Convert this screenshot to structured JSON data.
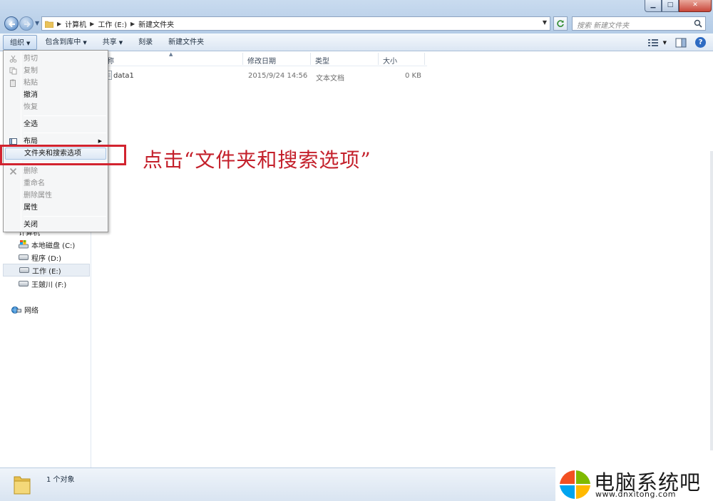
{
  "address": {
    "segments": [
      "计算机",
      "工作 (E:)",
      "新建文件夹"
    ]
  },
  "search": {
    "placeholder": "搜索 新建文件夹"
  },
  "window_controls": {
    "minimize": "▁",
    "maximize": "□",
    "close": "✕"
  },
  "toolbar": {
    "organize": "组织",
    "include_library": "包含到库中",
    "share": "共享",
    "burn": "刻录",
    "new_folder": "新建文件夹",
    "caret": "▼",
    "help": "?"
  },
  "columns": {
    "name_partial": "称",
    "date": "修改日期",
    "type": "类型",
    "size": "大小"
  },
  "files": [
    {
      "name": "data1",
      "date": "2015/9/24 14:56",
      "type": "文本文档",
      "size": "0 KB"
    }
  ],
  "menu": {
    "items": [
      {
        "label": "剪切",
        "enabled": false
      },
      {
        "label": "复制",
        "enabled": false
      },
      {
        "label": "粘贴",
        "enabled": false
      },
      {
        "label": "撤消",
        "enabled": true
      },
      {
        "label": "恢复",
        "enabled": false
      },
      {
        "label": "全选",
        "enabled": true
      },
      {
        "label": "布局",
        "enabled": true
      },
      {
        "label": "文件夹和搜索选项",
        "enabled": true
      },
      {
        "label": "删除",
        "enabled": false
      },
      {
        "label": "重命名",
        "enabled": false
      },
      {
        "label": "删除属性",
        "enabled": false
      },
      {
        "label": "属性",
        "enabled": true
      },
      {
        "label": "关闭",
        "enabled": true
      }
    ]
  },
  "annotation": {
    "text": "点击“文件夹和搜索选项”",
    "color": "#c4202b"
  },
  "navpane": {
    "computer_partial": "计算机",
    "drives": [
      "本地磁盘 (C:)",
      "程序 (D:)",
      "工作 (E:)",
      "王皴川 (F:)"
    ],
    "network": "网络"
  },
  "status": {
    "text": "1 个对象"
  },
  "watermark": {
    "title": "电脑系统吧",
    "url": "www.dnxitong.com"
  }
}
